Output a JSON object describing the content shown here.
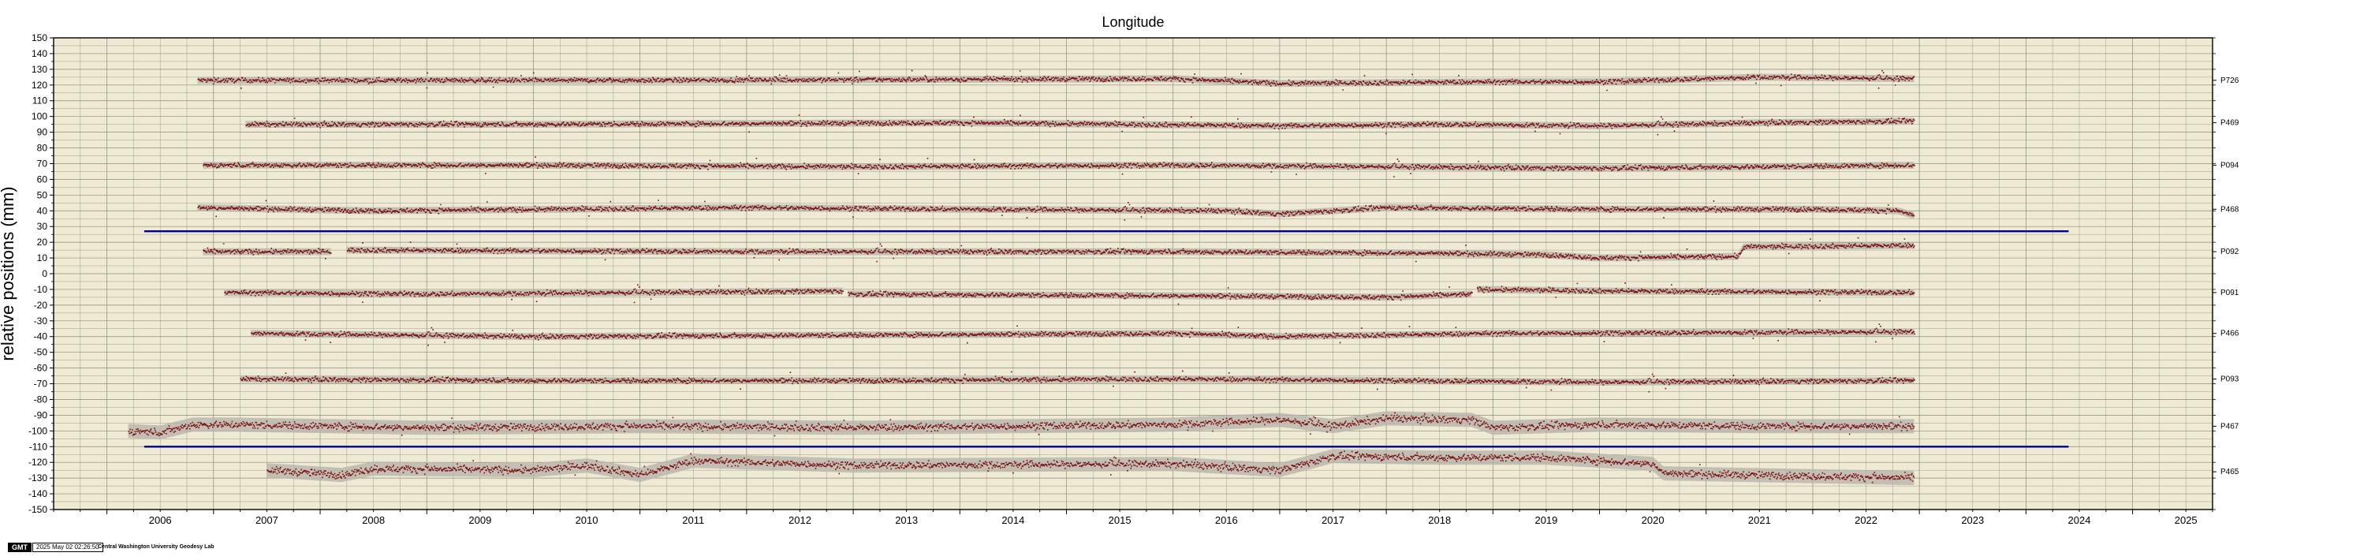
{
  "chart_data": {
    "type": "scatter",
    "title": "Longitude",
    "ylabel": "relative positions (mm)",
    "xlabel": "",
    "xlim": [
      2005.5,
      2025.75
    ],
    "ylim": [
      -150,
      150
    ],
    "x_ticks": [
      "2006",
      "2007",
      "2008",
      "2009",
      "2010",
      "2011",
      "2012",
      "2013",
      "2014",
      "2015",
      "2016",
      "2017",
      "2018",
      "2019",
      "2020",
      "2021",
      "2022",
      "2023",
      "2024",
      "2025"
    ],
    "y_ticks": [
      "150",
      "140",
      "130",
      "120",
      "110",
      "100",
      "90",
      "80",
      "70",
      "60",
      "50",
      "40",
      "30",
      "20",
      "10",
      "0",
      "-10",
      "-20",
      "-30",
      "-40",
      "-50",
      "-60",
      "-70",
      "-80",
      "-90",
      "-100",
      "-110",
      "-120",
      "-130",
      "-140",
      "-150"
    ],
    "grid": true,
    "series": [
      {
        "name": "P726",
        "offset": 123,
        "start": 2006.85,
        "end": 2022.95,
        "segments": [
          [
            2006.85,
            2022.95
          ]
        ],
        "trend": [
          [
            2006.85,
            123
          ],
          [
            2011.0,
            123
          ],
          [
            2016.0,
            124
          ],
          [
            2017.0,
            121
          ],
          [
            2019.0,
            122
          ],
          [
            2020.0,
            122
          ],
          [
            2021.5,
            125
          ],
          [
            2022.95,
            124
          ]
        ]
      },
      {
        "name": "P469",
        "offset": 96,
        "start": 2007.3,
        "end": 2022.95,
        "segments": [
          [
            2007.3,
            2022.95
          ]
        ],
        "trend": [
          [
            2007.3,
            95
          ],
          [
            2010.0,
            95
          ],
          [
            2014.0,
            96
          ],
          [
            2017.0,
            94
          ],
          [
            2018.5,
            95
          ],
          [
            2020.0,
            94
          ],
          [
            2021.5,
            96
          ],
          [
            2022.95,
            97
          ]
        ]
      },
      {
        "name": "P094",
        "offset": 69,
        "start": 2006.9,
        "end": 2022.95,
        "segments": [
          [
            2006.9,
            2022.95
          ]
        ],
        "trend": [
          [
            2006.9,
            69
          ],
          [
            2010.0,
            69
          ],
          [
            2013.0,
            68
          ],
          [
            2016.0,
            69
          ],
          [
            2018.0,
            68
          ],
          [
            2020.0,
            67
          ],
          [
            2022.95,
            69
          ]
        ]
      },
      {
        "name": "P468",
        "offset": 41,
        "start": 2006.85,
        "end": 2022.95,
        "segments": [
          [
            2006.85,
            2022.95
          ]
        ],
        "trend": [
          [
            2006.85,
            42
          ],
          [
            2008.5,
            40
          ],
          [
            2012.0,
            42
          ],
          [
            2014.0,
            41
          ],
          [
            2016.5,
            40
          ],
          [
            2017.0,
            38
          ],
          [
            2018.0,
            42
          ],
          [
            2020.0,
            41
          ],
          [
            2022.0,
            41
          ],
          [
            2022.8,
            40
          ],
          [
            2022.95,
            37
          ]
        ]
      },
      {
        "name": "P092",
        "offset": 14,
        "start": 2006.9,
        "end": 2022.95,
        "segments": [
          [
            2006.9,
            2008.1
          ],
          [
            2008.25,
            2022.95
          ]
        ],
        "trend": [
          [
            2006.9,
            14
          ],
          [
            2008.1,
            14
          ],
          [
            2008.25,
            15
          ],
          [
            2012.0,
            14
          ],
          [
            2016.0,
            14
          ],
          [
            2018.5,
            13
          ],
          [
            2019.5,
            12
          ],
          [
            2020.0,
            10
          ],
          [
            2021.3,
            11
          ],
          [
            2021.35,
            17
          ],
          [
            2022.95,
            18
          ]
        ]
      },
      {
        "name": "P091",
        "offset": -12,
        "start": 2007.1,
        "end": 2022.95,
        "segments": [
          [
            2007.1,
            2012.9
          ],
          [
            2012.95,
            2018.8
          ],
          [
            2018.85,
            2022.95
          ]
        ],
        "trend": [
          [
            2007.1,
            -12
          ],
          [
            2009.0,
            -13
          ],
          [
            2011.0,
            -12
          ],
          [
            2012.9,
            -11
          ],
          [
            2012.95,
            -13
          ],
          [
            2016.0,
            -14
          ],
          [
            2018.0,
            -15
          ],
          [
            2018.8,
            -13
          ],
          [
            2018.85,
            -10
          ],
          [
            2020.0,
            -11
          ],
          [
            2022.95,
            -12
          ]
        ]
      },
      {
        "name": "P466",
        "offset": -38,
        "start": 2007.35,
        "end": 2022.95,
        "segments": [
          [
            2007.35,
            2022.95
          ]
        ],
        "trend": [
          [
            2007.35,
            -38
          ],
          [
            2010.0,
            -40
          ],
          [
            2013.0,
            -39
          ],
          [
            2016.0,
            -38
          ],
          [
            2017.0,
            -40
          ],
          [
            2019.0,
            -38
          ],
          [
            2022.95,
            -37
          ]
        ]
      },
      {
        "name": "P093",
        "offset": -67,
        "start": 2007.25,
        "end": 2022.95,
        "segments": [
          [
            2007.25,
            2022.95
          ]
        ],
        "trend": [
          [
            2007.25,
            -67
          ],
          [
            2010.0,
            -68
          ],
          [
            2013.0,
            -68
          ],
          [
            2016.0,
            -67
          ],
          [
            2018.0,
            -68
          ],
          [
            2020.0,
            -69
          ],
          [
            2022.95,
            -68
          ]
        ]
      },
      {
        "name": "P467",
        "offset": -97,
        "start": 2006.2,
        "end": 2022.95,
        "segments": [
          [
            2006.2,
            2022.95
          ]
        ],
        "trend": [
          [
            2006.2,
            -100
          ],
          [
            2006.5,
            -101
          ],
          [
            2006.8,
            -96
          ],
          [
            2007.2,
            -96
          ],
          [
            2009.0,
            -98
          ],
          [
            2011.0,
            -97
          ],
          [
            2013.0,
            -98
          ],
          [
            2016.0,
            -96
          ],
          [
            2017.0,
            -93
          ],
          [
            2017.5,
            -97
          ],
          [
            2018.0,
            -92
          ],
          [
            2018.8,
            -93
          ],
          [
            2019.0,
            -98
          ],
          [
            2020.0,
            -96
          ],
          [
            2021.5,
            -97
          ],
          [
            2022.95,
            -97
          ]
        ]
      },
      {
        "name": "P465",
        "offset": -126,
        "start": 2007.5,
        "end": 2022.95,
        "segments": [
          [
            2007.5,
            2022.95
          ]
        ],
        "trend": [
          [
            2007.5,
            -125
          ],
          [
            2008.2,
            -128
          ],
          [
            2008.5,
            -124
          ],
          [
            2010.0,
            -125
          ],
          [
            2010.5,
            -122
          ],
          [
            2011.0,
            -128
          ],
          [
            2011.5,
            -119
          ],
          [
            2013.0,
            -122
          ],
          [
            2016.0,
            -121
          ],
          [
            2017.0,
            -125
          ],
          [
            2017.5,
            -116
          ],
          [
            2018.5,
            -117
          ],
          [
            2019.5,
            -117
          ],
          [
            2020.5,
            -121
          ],
          [
            2020.6,
            -127
          ],
          [
            2022.95,
            -130
          ]
        ]
      }
    ],
    "reference_lines": [
      {
        "y": 27,
        "x_start": 2006.35,
        "x_end": 2024.4,
        "color": "#00008b"
      },
      {
        "y": -110,
        "x_start": 2006.35,
        "x_end": 2024.4,
        "color": "#00008b"
      }
    ]
  },
  "colors": {
    "plot_background": "#eeead3",
    "grid": "#8c8c7c",
    "point": "#7a0b0b",
    "uncertainty_band": "#b8b4ac",
    "reference_line": "#00008b"
  },
  "footer": {
    "logo_text": "GMT",
    "timestamp": "2025 May 02 02:26:50",
    "lab_name": "Central Washington University Geodesy Lab"
  }
}
